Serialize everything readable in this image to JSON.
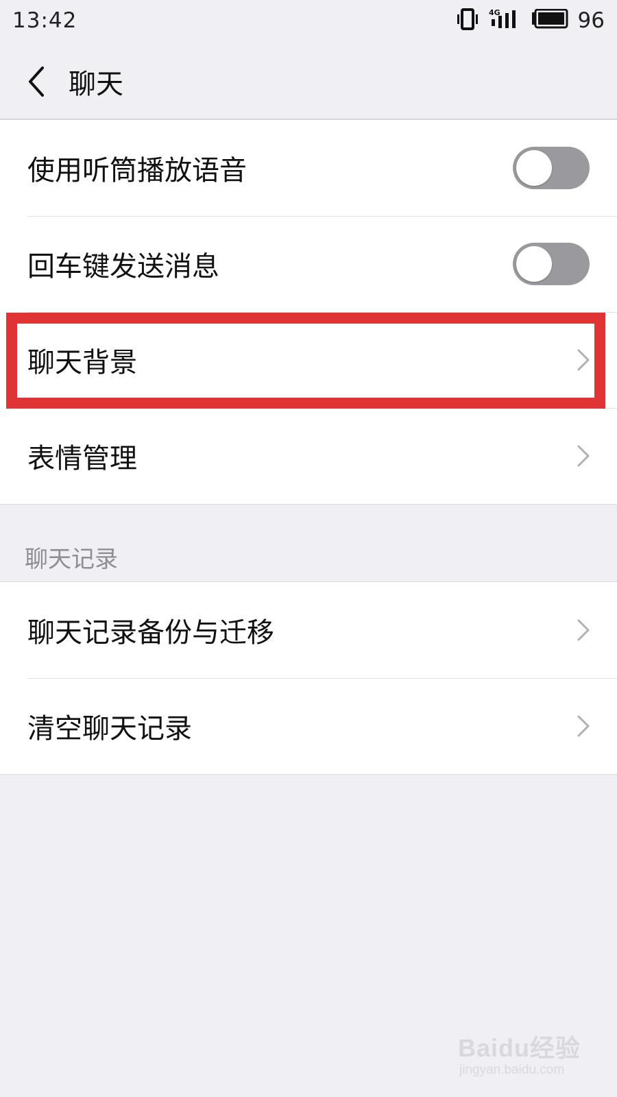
{
  "status_bar": {
    "time": "13:42",
    "network": "4G",
    "battery_percent": "96",
    "icons": [
      "vibrate-icon",
      "signal-4g-icon",
      "battery-icon"
    ]
  },
  "nav": {
    "back_icon": "chevron-left-icon",
    "title": "聊天"
  },
  "settings": {
    "group1": [
      {
        "label": "使用听筒播放语音",
        "control": "toggle",
        "on": false
      },
      {
        "label": "回车键发送消息",
        "control": "toggle",
        "on": false
      },
      {
        "label": "聊天背景",
        "control": "chevron",
        "highlighted": true
      },
      {
        "label": "表情管理",
        "control": "chevron"
      }
    ],
    "section_header": "聊天记录",
    "group2": [
      {
        "label": "聊天记录备份与迁移",
        "control": "chevron"
      },
      {
        "label": "清空聊天记录",
        "control": "chevron"
      }
    ]
  },
  "annotation": {
    "highlight_color": "#e03434",
    "target": "聊天背景"
  },
  "watermark": {
    "brand": "Baidu经验",
    "url": "jingyan.baidu.com"
  },
  "colors": {
    "background": "#efeff4",
    "toggle_off": "#9a9a9e",
    "secondary_text": "#8e8e93"
  }
}
